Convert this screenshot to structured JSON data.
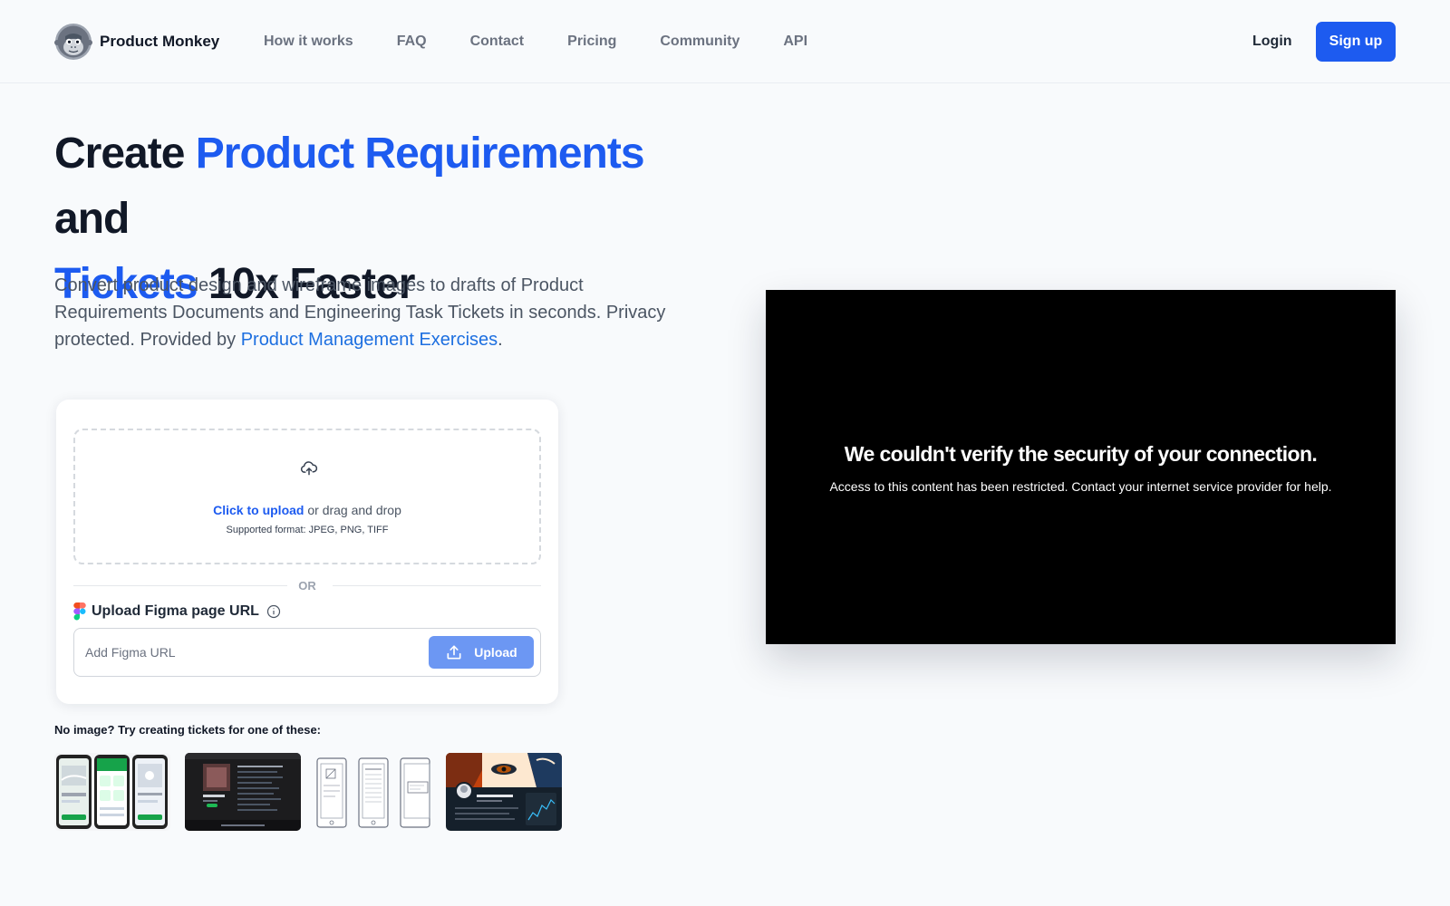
{
  "nav": {
    "brand": "Product Monkey",
    "links": [
      "How it works",
      "FAQ",
      "Contact",
      "Pricing",
      "Community",
      "API"
    ],
    "login": "Login",
    "signup": "Sign up"
  },
  "hero": {
    "title_part1": "Create ",
    "title_accent1": "Product Requirements",
    "title_part2": " and",
    "title_accent2": "Tickets",
    "title_part3": " 10x Faster",
    "desc_text": "Convert product design and wireframe images to drafts of Product Requirements Documents and Engineering Task Tickets in seconds. Privacy protected. Provided by ",
    "desc_link": "Product Management Exercises",
    "desc_end": "."
  },
  "upload": {
    "click_text": "Click to upload",
    "drag_text": " or drag and drop",
    "formats": "Supported format: JPEG, PNG, TIFF",
    "or": "OR",
    "figma_label": "Upload Figma page URL",
    "url_placeholder": "Add Figma URL",
    "upload_button": "Upload"
  },
  "samples": {
    "title": "No image? Try creating tickets for one of these:",
    "items": [
      "mobile-app-screens",
      "dark-music-app",
      "phone-wireframes",
      "illustrated-social-profile"
    ]
  },
  "video": {
    "error_title": "We couldn't verify the security of your connection.",
    "error_sub": "Access to this content has been restricted. Contact your internet service provider for help."
  },
  "colors": {
    "accent": "#1d5bf0",
    "link": "#1d6fe0",
    "upload_button": "#6c97f3",
    "background": "#f8fafc"
  }
}
